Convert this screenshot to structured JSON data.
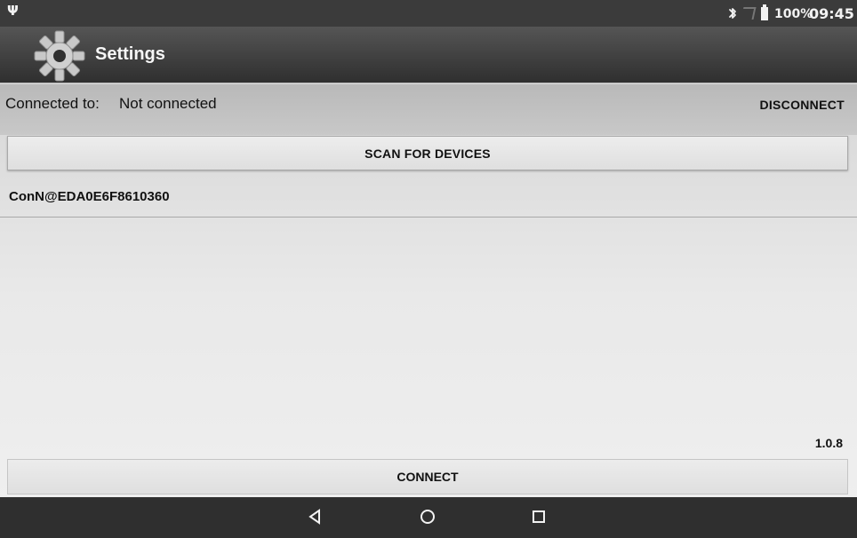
{
  "status_bar": {
    "usb_icon": "usb-icon",
    "bluetooth_icon": "bluetooth-icon",
    "signal_icon": "signal-icon",
    "battery_icon": "battery-icon",
    "battery_level": "100%",
    "time": "09:45"
  },
  "toolbar": {
    "logo_icon": "gear-icon",
    "title": "Settings"
  },
  "connection": {
    "prefix": "Connected to:",
    "status": "Not connected",
    "disconnect_label": "DISCONNECT"
  },
  "scan": {
    "label": "SCAN FOR DEVICES"
  },
  "devices": [
    {
      "name": "ConN@EDA0E6F8610360"
    }
  ],
  "version": "1.0.8",
  "connect": {
    "label": "CONNECT"
  },
  "navigation": {
    "back_icon": "back-icon",
    "home_icon": "home-icon",
    "recents_icon": "recents-icon"
  },
  "colors": {
    "status_bar": "#3b3b3b",
    "toolbar": "#2f2f2f",
    "background": "#d7d7d7"
  }
}
